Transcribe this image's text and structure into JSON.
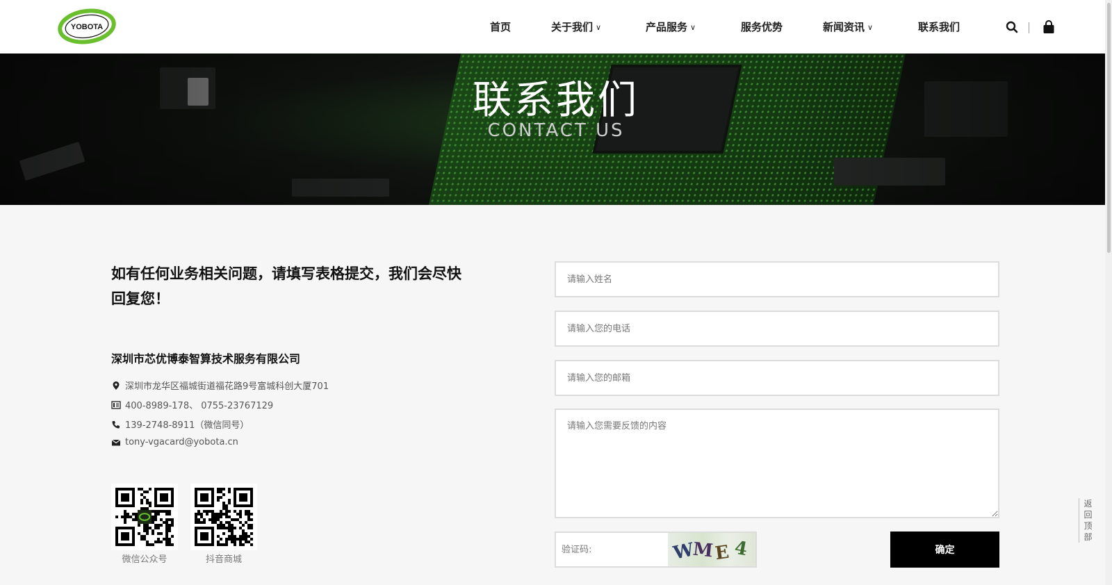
{
  "header": {
    "logo_text": "YOBOTA",
    "nav": [
      {
        "label": "首页",
        "dropdown": false
      },
      {
        "label": "关于我们",
        "dropdown": true
      },
      {
        "label": "产品服务",
        "dropdown": true
      },
      {
        "label": "服务优势",
        "dropdown": false
      },
      {
        "label": "新闻资讯",
        "dropdown": true
      },
      {
        "label": "联系我们",
        "dropdown": false
      }
    ],
    "icons": [
      "search-icon",
      "shopping-bag-icon"
    ]
  },
  "banner": {
    "title": "联系我们",
    "subtitle": "CONTACT US"
  },
  "contact": {
    "intro": "如有任何业务相关问题，请填写表格提交，我们会尽快回复您！",
    "company": "深圳市芯优博泰智算技术服务有限公司",
    "address": "深圳市龙华区福城街道福花路9号富城科创大厦701",
    "phone": "400-8989-178、 0755-23767129",
    "mobile": "139-2748-8911（微信同号）",
    "email": "tony-vgacard@yobota.cn",
    "qr": [
      {
        "label": "微信公众号"
      },
      {
        "label": "抖音商城"
      }
    ]
  },
  "form": {
    "name_placeholder": "请输入姓名",
    "phone_placeholder": "请输入您的电话",
    "email_placeholder": "请输入您的邮箱",
    "message_placeholder": "请输入您需要反馈的内容",
    "captcha_placeholder": "验证码:",
    "captcha_chars": [
      "W",
      "M",
      "E",
      "4"
    ],
    "submit_label": "确定"
  },
  "back_to_top": [
    "返",
    "回",
    "顶",
    "部"
  ],
  "colors": {
    "brand_green": "#6abf2e",
    "submit_bg": "#000000"
  }
}
